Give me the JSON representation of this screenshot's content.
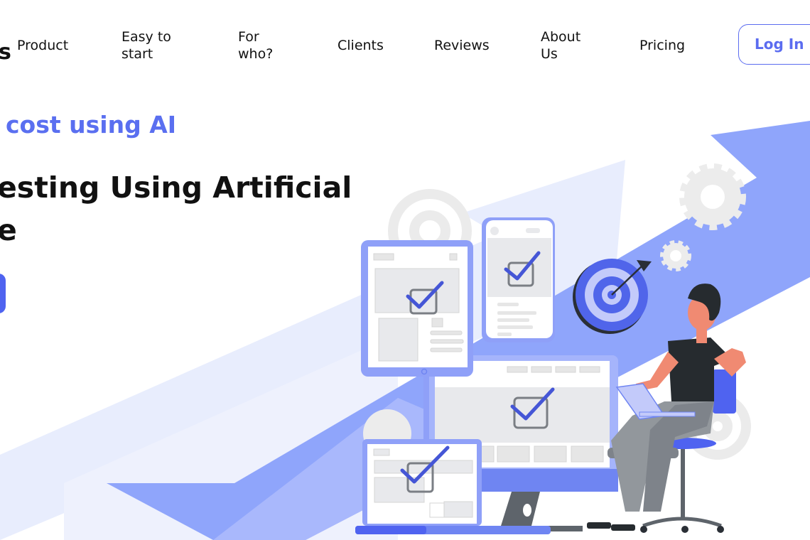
{
  "header": {
    "logo_text": "s",
    "nav": [
      {
        "label": "Product"
      },
      {
        "label": "Easy to start"
      },
      {
        "label": "For who?"
      },
      {
        "label": "Clients"
      },
      {
        "label": "Reviews"
      },
      {
        "label": "About Us"
      },
      {
        "label": "Pricing"
      }
    ],
    "login_label": "Log In"
  },
  "hero": {
    "subtitle": "cost using AI",
    "headline_line1": "esting Using Artificial",
    "headline_line2": "e"
  },
  "colors": {
    "accent": "#5a6ff0",
    "button": "#4f63f0",
    "arrow": "#8fa5fb",
    "arrow_light": "#e8edfd"
  }
}
